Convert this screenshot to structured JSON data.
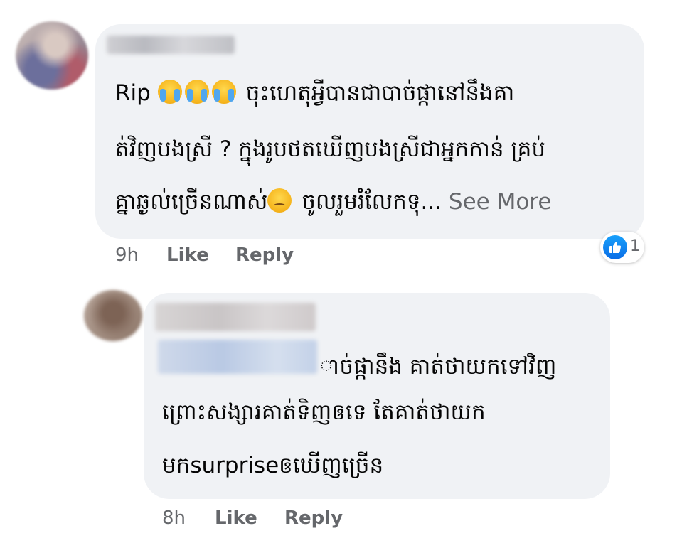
{
  "comments": [
    {
      "lines": [
        "Rip",
        "ចុះហេតុអ្វីបានជាបាច់ផ្កានៅនឹងគា",
        "ត់វិញបងស្រី ? ក្នុងរូបថតឃើញបងស្រីជាអ្នកកាន់ គ្រប់",
        "គ្នាឆ្ងល់ច្រើនណាស់",
        "ចូលរួមរំលែកទុ..."
      ],
      "see_more": "See More",
      "time": "9h",
      "like": "Like",
      "reply": "Reply",
      "reaction_count": "1"
    },
    {
      "lines": [
        "ាច់ផ្កានឹង គាត់ថាយកទៅវិញ",
        "ព្រោះសង្សារគាត់ទិញឲទេ តែគាត់ថាយក",
        "មកsurpriseឲឃើញច្រើន"
      ],
      "time": "8h",
      "like": "Like",
      "reply": "Reply"
    }
  ],
  "emojis": {
    "crying": "loudly-crying-face-icon",
    "pensive": "pensive-face-icon",
    "like": "like-thumb-icon"
  },
  "colors": {
    "bubble": "#f0f2f5",
    "meta": "#65676b",
    "like_blue": "#1877f2"
  }
}
